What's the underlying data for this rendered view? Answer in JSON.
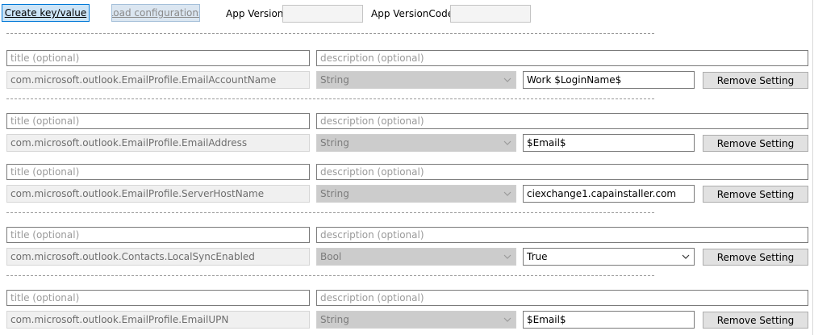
{
  "toolbar": {
    "create_label": "Create key/value",
    "load_label": "Load configurations",
    "app_version_label": "App Version",
    "app_version_value": "",
    "app_versioncode_label": "App VersionCode",
    "app_versioncode_value": ""
  },
  "placeholders": {
    "title": "title (optional)",
    "description": "description (optional)"
  },
  "remove_label": "Remove Setting",
  "settings": [
    {
      "key": "com.microsoft.outlook.EmailProfile.EmailAccountName",
      "type": "String",
      "value": "Work $LoginName$"
    },
    {
      "key": "com.microsoft.outlook.EmailProfile.EmailAddress",
      "type": "String",
      "value": "$Email$"
    },
    {
      "key": "com.microsoft.outlook.EmailProfile.ServerHostName",
      "type": "String",
      "value": "ciexchange1.capainstaller.com"
    },
    {
      "key": "com.microsoft.outlook.Contacts.LocalSyncEnabled",
      "type": "Bool",
      "value": "True"
    },
    {
      "key": "com.microsoft.outlook.EmailProfile.EmailUPN",
      "type": "String",
      "value": "$Email$"
    }
  ]
}
